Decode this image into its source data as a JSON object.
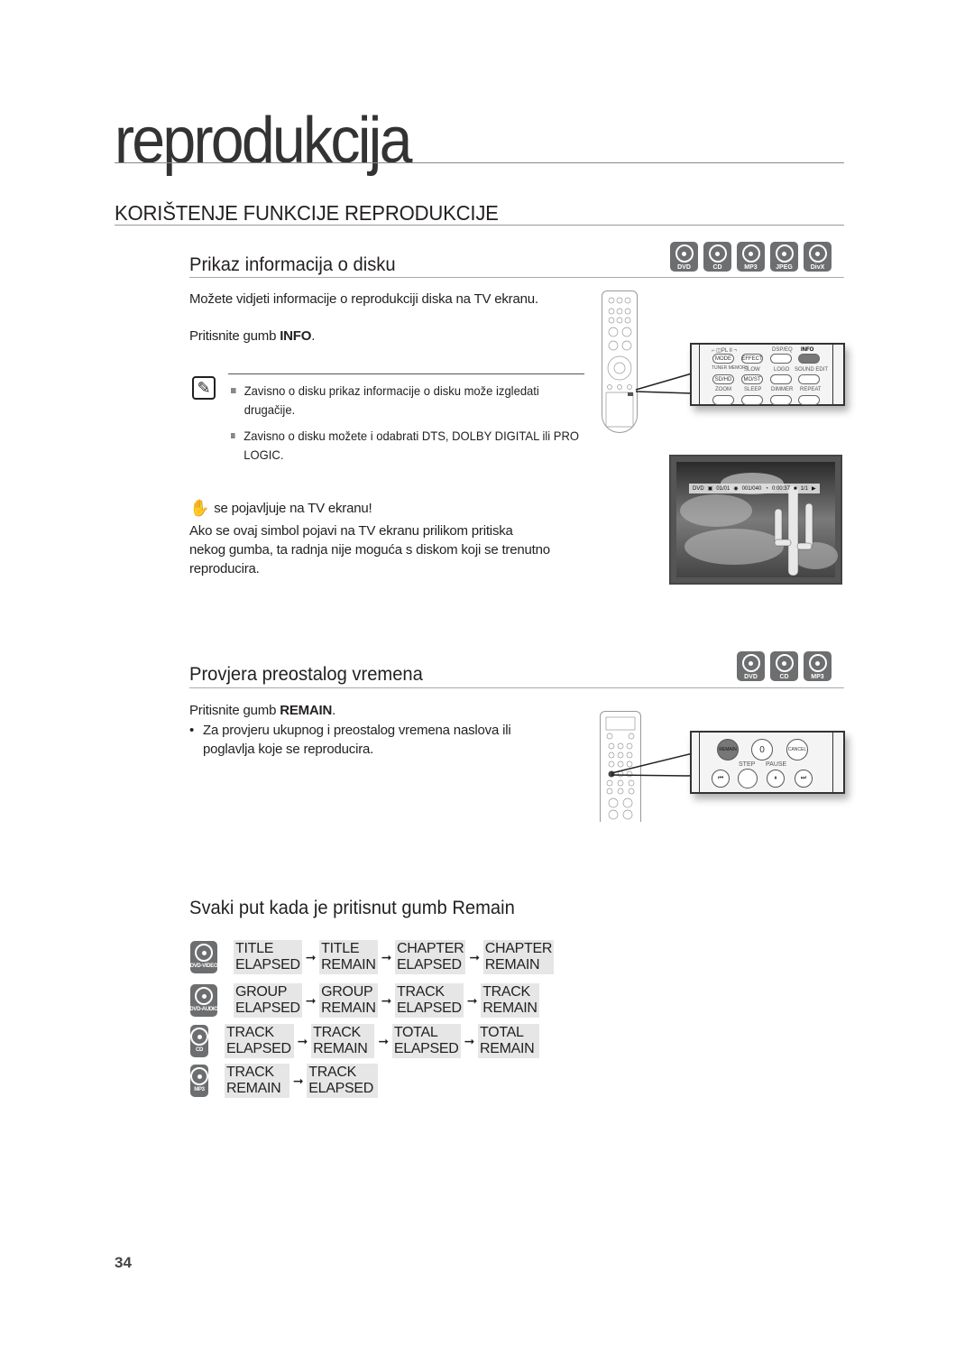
{
  "page": {
    "chapter_title": "reprodukcija",
    "section_title": "KORIŠTENJE FUNKCIJE REPRODUKCIJE",
    "page_number": "34"
  },
  "disk_info": {
    "title": "Prikaz informacija o disku",
    "disc_types": [
      "DVD",
      "CD",
      "MP3",
      "JPEG",
      "DivX"
    ],
    "intro": "Možete vidjeti informacije o reprodukciji diska na TV ekranu.",
    "press_prefix": "Pritisnite gumb ",
    "press_button": "INFO",
    "press_suffix": ".",
    "notes": [
      "Zavisno o disku prikaz informacije o disku može izgledati drugačije.",
      "Zavisno o disku možete i odabrati DTS, DOLBY DIGITAL ili PRO LOGIC."
    ],
    "hand_heading": "se pojavljuje na TV ekranu!",
    "hand_text": "Ako se ovaj simbol pojavi na TV ekranu prilikom pritiska nekog gumba, ta radnja nije moguća s diskom koji se trenutno reproducira.",
    "remote_zoom": {
      "row1_labels": [
        "⌐ ◫PL II ¬",
        "DSP/EQ",
        "INFO"
      ],
      "row1_buttons": [
        "MODE",
        "EFFECT",
        "",
        ""
      ],
      "row2_labels": [
        "TUNER MEMORY",
        "SLOW",
        "LOGO",
        "SOUND EDIT"
      ],
      "row2_buttons": [
        "SD/HD",
        "MO/ST",
        "",
        ""
      ],
      "row3_labels": [
        "ZOOM",
        "SLEEP",
        "DIMMER",
        "REPEAT"
      ]
    },
    "osd": {
      "disc": "DVD",
      "title": "01/01",
      "chapter": "001/040",
      "time": "0:00:37",
      "angle": "1/1"
    }
  },
  "remain": {
    "title": "Provjera preostalog vremena",
    "disc_types": [
      "DVD",
      "CD",
      "MP3"
    ],
    "press_prefix": "Pritisnite gumb ",
    "press_button": "REMAIN",
    "press_suffix": ".",
    "bullet": "Za provjeru ukupnog i preostalog vremena naslova ili poglavlja koje se reproducira.",
    "remote_zoom": {
      "buttons": [
        "REMAIN",
        "0",
        "CANCEL"
      ],
      "labels": [
        "STEP",
        "PAUSE"
      ]
    }
  },
  "sequence": {
    "title": "Svaki put kada je pritisnut gumb Remain",
    "rows": [
      {
        "disc": "DVD-VIDEO",
        "items": [
          "TITLE ELAPSED",
          "TITLE REMAIN",
          "CHAPTER ELAPSED",
          "CHAPTER REMAIN"
        ]
      },
      {
        "disc": "DVD-AUDIO",
        "items": [
          "GROUP ELAPSED",
          "GROUP REMAIN",
          "TRACK ELAPSED",
          "TRACK REMAIN"
        ]
      },
      {
        "disc": "CD",
        "items": [
          "TRACK ELAPSED",
          "TRACK REMAIN",
          "TOTAL ELAPSED",
          "TOTAL REMAIN"
        ]
      },
      {
        "disc": "MP3",
        "items": [
          "TRACK REMAIN",
          "TRACK ELAPSED"
        ]
      }
    ],
    "arrow": "➞"
  }
}
